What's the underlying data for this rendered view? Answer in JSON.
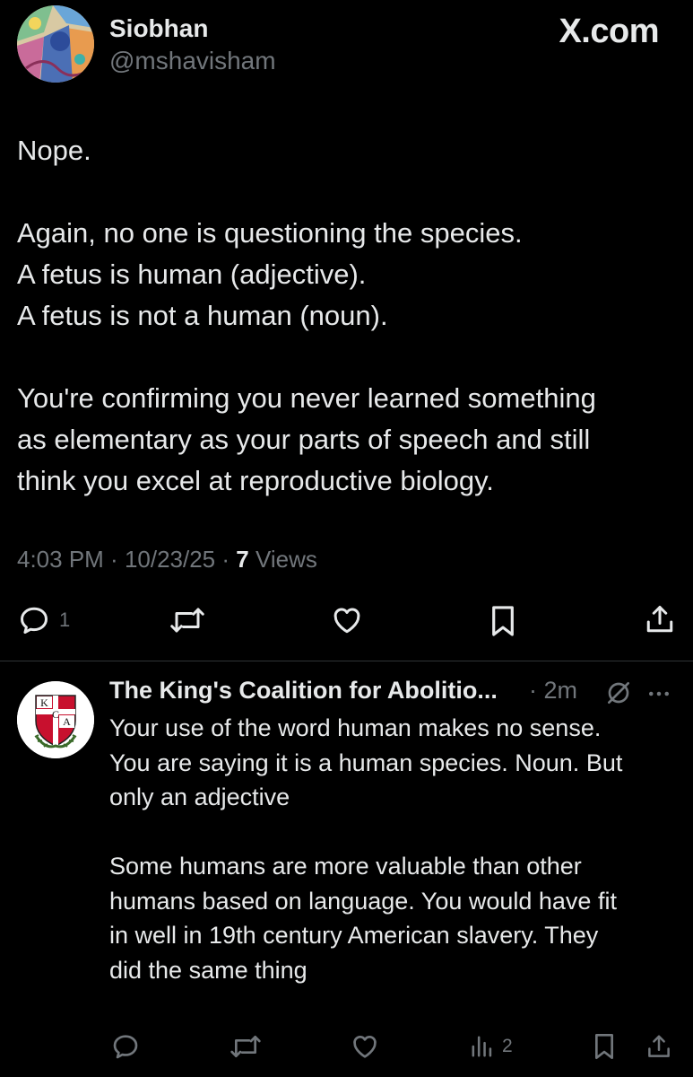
{
  "main_post": {
    "author_name": "Siobhan",
    "author_handle": "@mshavisham",
    "brand": "X.com",
    "lines_1": [
      "Nope."
    ],
    "lines_2": [
      "Again, no one is questioning the species.",
      "A fetus is human (adjective).",
      "A fetus is not a human (noun)."
    ],
    "lines_3": [
      "You're confirming you never learned something",
      "as elementary as your parts of speech and still",
      "think you excel at reproductive biology."
    ],
    "time": "4:03 PM",
    "date": "10/23/25",
    "views_count": "7",
    "views_label": "Views",
    "actions": {
      "reply_icon": "reply-icon",
      "reply_count": "1",
      "repost_icon": "repost-icon",
      "like_icon": "like-icon",
      "bookmark_icon": "bookmark-icon",
      "share_icon": "share-icon"
    }
  },
  "reply": {
    "author_name": "The King's Coalition for Abolitio...",
    "time": "· 2m",
    "avatar_letters": [
      "K",
      "C",
      "A"
    ],
    "lines_1": [
      "Your use of the word human makes no sense.",
      "You are saying it is a human species. Noun. But",
      "only an adjective"
    ],
    "lines_2": [
      "Some humans are more valuable than other",
      "humans based on language. You would have fit",
      "in well in 19th century American slavery. They",
      "did the same thing"
    ],
    "actions": {
      "reply_icon": "reply-icon",
      "repost_icon": "repost-icon",
      "like_icon": "like-icon",
      "views_icon": "views-icon",
      "views_count": "2",
      "bookmark_icon": "bookmark-icon",
      "share_icon": "share-icon"
    }
  },
  "colors": {
    "background": "#000000",
    "text_primary": "#e7e9ea",
    "text_secondary": "#71767b",
    "divider": "#2f3336"
  }
}
